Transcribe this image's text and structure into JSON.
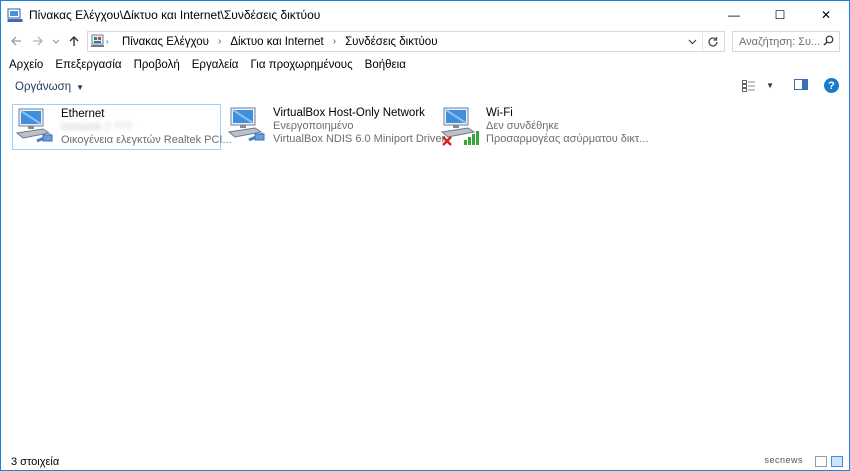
{
  "window": {
    "title": "Πίνακας Ελέγχου\\Δίκτυο και Internet\\Συνδέσεις δικτύου",
    "controls": {
      "minimize": "—",
      "maximize": "☐",
      "close": "✕"
    }
  },
  "address_bar": {
    "breadcrumbs": [
      "Πίνακας Ελέγχου",
      "Δίκτυο και Internet",
      "Συνδέσεις δικτύου"
    ],
    "separator": "›"
  },
  "search": {
    "placeholder": "Αναζήτηση: Συ..."
  },
  "menu": {
    "items": [
      "Αρχείο",
      "Επεξεργασία",
      "Προβολή",
      "Εργαλεία",
      "Για προχωρημένους",
      "Βοήθεια"
    ]
  },
  "command_bar": {
    "organize_label": "Οργάνωση",
    "help_label": "?"
  },
  "connections": [
    {
      "name": "Ethernet",
      "status": "Network 2 ???",
      "device": "Οικογένεια ελεγκτών Realtek PCI..."
    },
    {
      "name": "VirtualBox Host-Only Network",
      "status": "Ενεργοποιημένο",
      "device": "VirtualBox NDIS 6.0 Miniport Driver"
    },
    {
      "name": "Wi-Fi",
      "status": "Δεν συνδέθηκε",
      "device": "Προσαρμογέας ασύρματου δικτ..."
    }
  ],
  "status_bar": {
    "item_count": "3 στοιχεία",
    "watermark": "secnews"
  },
  "colors": {
    "accent": "#1883d7",
    "selection_border": "#99d1ff",
    "wifi_bars": "#3aa53a",
    "error_x": "#d42020"
  }
}
